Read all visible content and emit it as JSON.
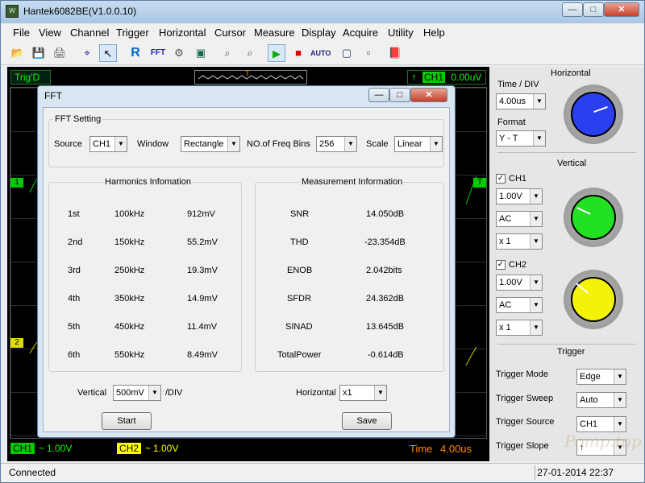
{
  "window": {
    "title": "Hantek6082BE(V1.0.0.10)",
    "icon_text": "W",
    "controls": [
      "—",
      "□",
      "✕"
    ]
  },
  "menu": [
    "File",
    "View",
    "Channel",
    "Trigger",
    "Horizontal",
    "Cursor",
    "Measure",
    "Display",
    "Acquire",
    "Utility",
    "Help"
  ],
  "toolbar": {
    "icons": [
      "open-icon",
      "save-icon",
      "print-icon",
      "cursor-cross-icon",
      "pointer-icon",
      "reference-icon",
      "fft-icon",
      "math-icon",
      "display-icon",
      "zoom-in-icon",
      "zoom-out-icon",
      "run-icon",
      "stop-icon",
      "auto-icon",
      "fit-icon",
      "layout-icon",
      "book-icon"
    ],
    "glyphs": [
      "📂",
      "💾",
      "🖨",
      "⌖",
      "↖",
      "R",
      "FFT",
      "⚙",
      "▣",
      "⌕",
      "⌕",
      "▶",
      "■",
      "AUTO",
      "▢",
      "▫",
      "📕"
    ]
  },
  "scope": {
    "trig_status": "Trig'D",
    "trigger_readout": "0.00uV",
    "trigger_channel": "CH1",
    "trigger_position_marker": "T",
    "ch1_marker": "1",
    "ch2_marker": "2",
    "right_marker": "T",
    "ch1_status": "CH1",
    "ch1_volts": "1.00V",
    "ch2_status": "CH2",
    "ch2_volts": "1.00V",
    "time_label": "Time",
    "time_value": "4.00us",
    "ch1_color": "#00cc00",
    "ch2_color": "#ffff00",
    "time_color": "#ff8800"
  },
  "fft": {
    "title": "FFT",
    "setting_title": "FFT Setting",
    "source_label": "Source",
    "source_value": "CH1",
    "window_label": "Window",
    "window_value": "Rectangle",
    "bins_label": "NO.of Freq Bins",
    "bins_value": "256",
    "scale_label": "Scale",
    "scale_value": "Linear",
    "harmonics_title": "Harmonics Infomation",
    "harmonics": [
      {
        "order": "1st",
        "freq": "100kHz",
        "amp": "912mV"
      },
      {
        "order": "2nd",
        "freq": "150kHz",
        "amp": "55.2mV"
      },
      {
        "order": "3rd",
        "freq": "250kHz",
        "amp": "19.3mV"
      },
      {
        "order": "4th",
        "freq": "350kHz",
        "amp": "14.9mV"
      },
      {
        "order": "5th",
        "freq": "450kHz",
        "amp": "11.4mV"
      },
      {
        "order": "6th",
        "freq": "550kHz",
        "amp": "8.49mV"
      }
    ],
    "measurement_title": "Measurement Information",
    "measurements": [
      {
        "name": "SNR",
        "value": "14.050dB"
      },
      {
        "name": "THD",
        "value": "-23.354dB"
      },
      {
        "name": "ENOB",
        "value": "2.042bits"
      },
      {
        "name": "SFDR",
        "value": "24.362dB"
      },
      {
        "name": "SINAD",
        "value": "13.645dB"
      },
      {
        "name": "TotalPower",
        "value": "-0.614dB"
      }
    ],
    "vertical_label": "Vertical",
    "vertical_value": "500mV",
    "vertical_unit": "/DIV",
    "horizontal_label": "Horizontal",
    "horizontal_value": "x1",
    "start_label": "Start",
    "save_label": "Save"
  },
  "panel": {
    "horizontal_title": "Horizontal",
    "timediv_label": "Time / DIV",
    "timediv_value": "4.00us",
    "format_label": "Format",
    "format_value": "Y - T",
    "vertical_title": "Vertical",
    "ch1_label": "CH1",
    "ch1_volts": "1.00V",
    "ch1_coupling": "AC",
    "ch1_probe": "x 1",
    "ch2_label": "CH2",
    "ch2_volts": "1.00V",
    "ch2_coupling": "AC",
    "ch2_probe": "x 1",
    "trigger_title": "Trigger",
    "trigger_mode_label": "Trigger Mode",
    "trigger_mode_value": "Edge",
    "trigger_sweep_label": "Trigger Sweep",
    "trigger_sweep_value": "Auto",
    "trigger_source_label": "Trigger Source",
    "trigger_source_value": "CH1",
    "trigger_slope_label": "Trigger Slope",
    "trigger_slope_value": "↑",
    "check_mark": "✓",
    "arrow_glyph": "▼",
    "knob_colors": {
      "horizontal": "#2a3ff0",
      "ch1": "#22e022",
      "ch2": "#f5f20a"
    }
  },
  "status": {
    "connection": "Connected",
    "date": "27-01-2014 22:37",
    "watermark": "Pomp.top"
  }
}
